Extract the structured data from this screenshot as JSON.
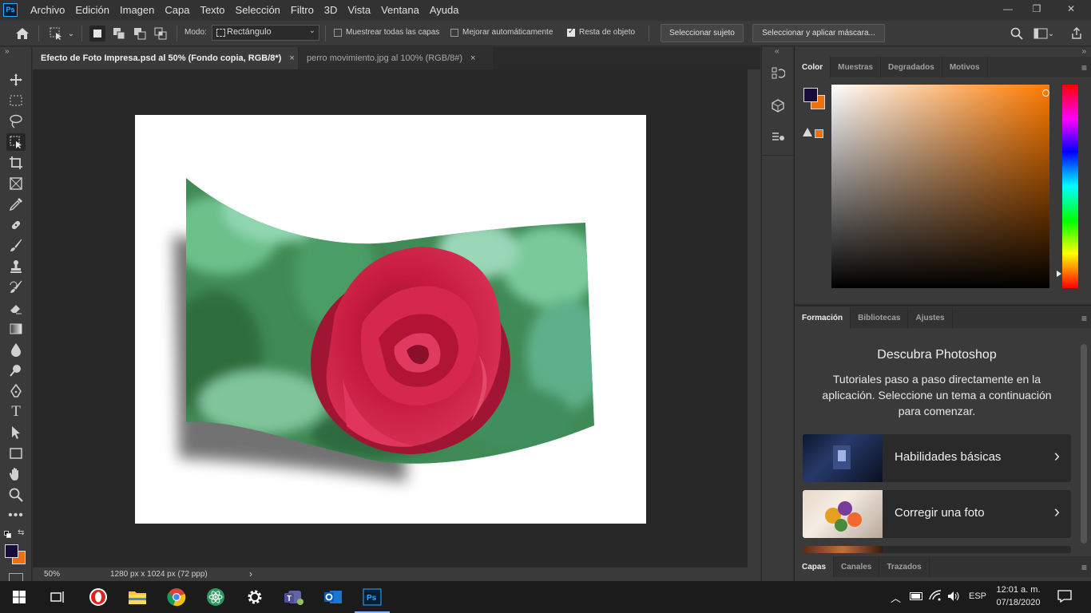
{
  "menubar": {
    "logo": "Ps",
    "items": [
      "Archivo",
      "Edición",
      "Imagen",
      "Capa",
      "Texto",
      "Selección",
      "Filtro",
      "3D",
      "Vista",
      "Ventana",
      "Ayuda"
    ],
    "window_controls": {
      "minimize": "—",
      "restore": "❐",
      "close": "✕"
    }
  },
  "options": {
    "mode_label": "Modo:",
    "mode_value": "Rectángulo",
    "sample_all_layers": {
      "label": "Muestrear todas las capas",
      "checked": false
    },
    "auto_enhance": {
      "label": "Mejorar automáticamente",
      "checked": false
    },
    "object_subtract": {
      "label": "Resta de objeto",
      "checked": true
    },
    "select_subject": "Seleccionar sujeto",
    "select_and_mask": "Seleccionar y aplicar máscara..."
  },
  "tabs": [
    {
      "label": "Efecto de Foto Impresa.psd al 50% (Fondo copia, RGB/8*)",
      "active": true,
      "close": "×"
    },
    {
      "label": "perro movimiento.jpg al 100% (RGB/8#)",
      "active": false,
      "close": "×"
    }
  ],
  "status": {
    "zoom": "50%",
    "doc_info": "1280 px x 1024 px (72 ppp)",
    "arrow": "›"
  },
  "toolbar": {
    "collapse": "»"
  },
  "color_panel": {
    "tabs": [
      "Color",
      "Muestras",
      "Degradados",
      "Motivos"
    ],
    "foreground": "#1a0b3d",
    "background": "#f07010",
    "hue_color": "#ff7a00",
    "warning_swatch": "#f07010"
  },
  "learn_panel": {
    "tabs": [
      "Formación",
      "Bibliotecas",
      "Ajustes"
    ],
    "title": "Descubra Photoshop",
    "subtitle": "Tutoriales paso a paso directamente en la aplicación. Seleccione un tema a continuación para comenzar.",
    "cards": [
      {
        "label": "Habilidades básicas"
      },
      {
        "label": "Corregir una foto"
      }
    ]
  },
  "layers_panel": {
    "tabs": [
      "Capas",
      "Canales",
      "Trazados"
    ]
  },
  "taskbar": {
    "language": "ESP",
    "time": "12:01 a. m.",
    "date": "07/18/2020"
  }
}
